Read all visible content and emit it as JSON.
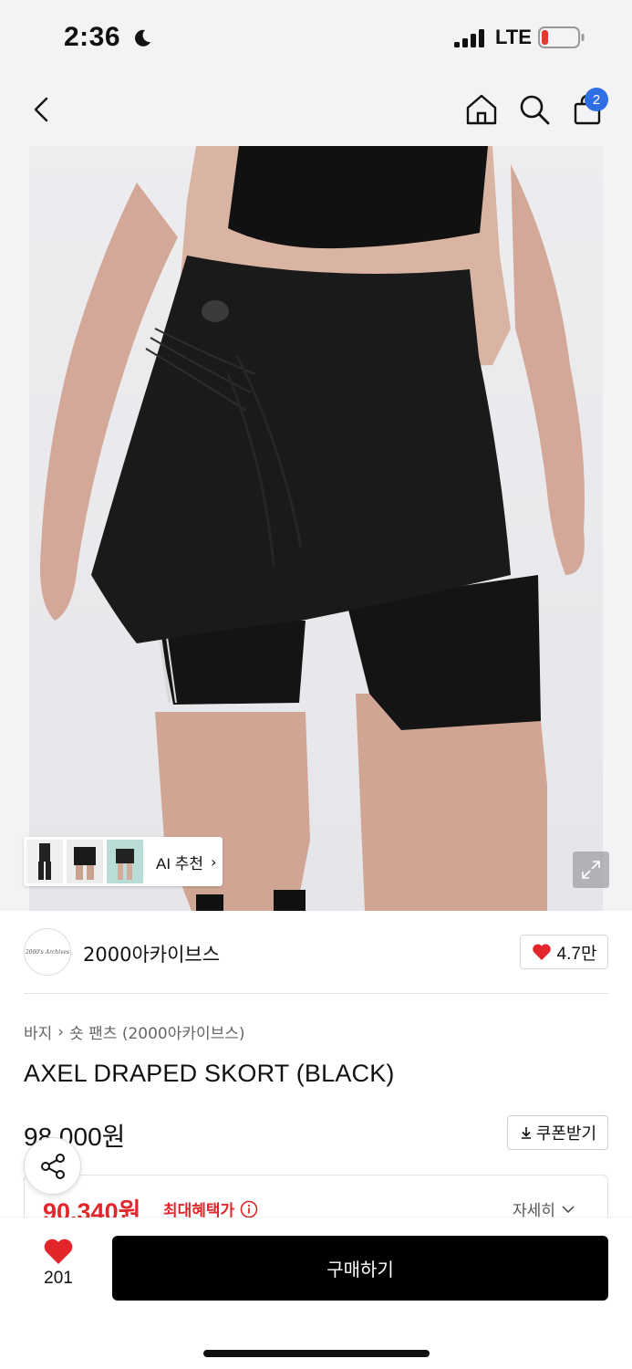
{
  "status_bar": {
    "time": "2:36",
    "network": "LTE",
    "moon_icon": "moon-icon",
    "signal_icon": "signal-bars-icon",
    "battery_icon": "battery-low-icon",
    "battery_color": "#e8372f"
  },
  "nav": {
    "back_icon": "chevron-left-icon",
    "home_icon": "home-icon",
    "search_icon": "search-icon",
    "bag_icon": "shopping-bag-icon",
    "bag_badge": "2",
    "badge_color": "#2f6fe4"
  },
  "gallery": {
    "ai_label": "AI 추천",
    "ai_chevron": "›",
    "expand_icon": "expand-icon"
  },
  "brand": {
    "logo_text": "2000's Archives",
    "name": "2000아카이브스",
    "like_count": "4.7만",
    "heart_color": "#e2262c"
  },
  "product": {
    "breadcrumb": [
      "바지",
      "숏 팬츠 (2000아카이브스)"
    ],
    "breadcrumb_separator": "›",
    "title": "AXEL DRAPED SKORT (BLACK)",
    "price": "98,000원",
    "coupon_label": "쿠폰받기",
    "benefit_price": "90,340원",
    "benefit_label": "최대혜택가",
    "detail_label": "자세히",
    "accent_color": "#e2262c"
  },
  "bottom_bar": {
    "wish_count": "201",
    "buy_label": "구매하기"
  }
}
